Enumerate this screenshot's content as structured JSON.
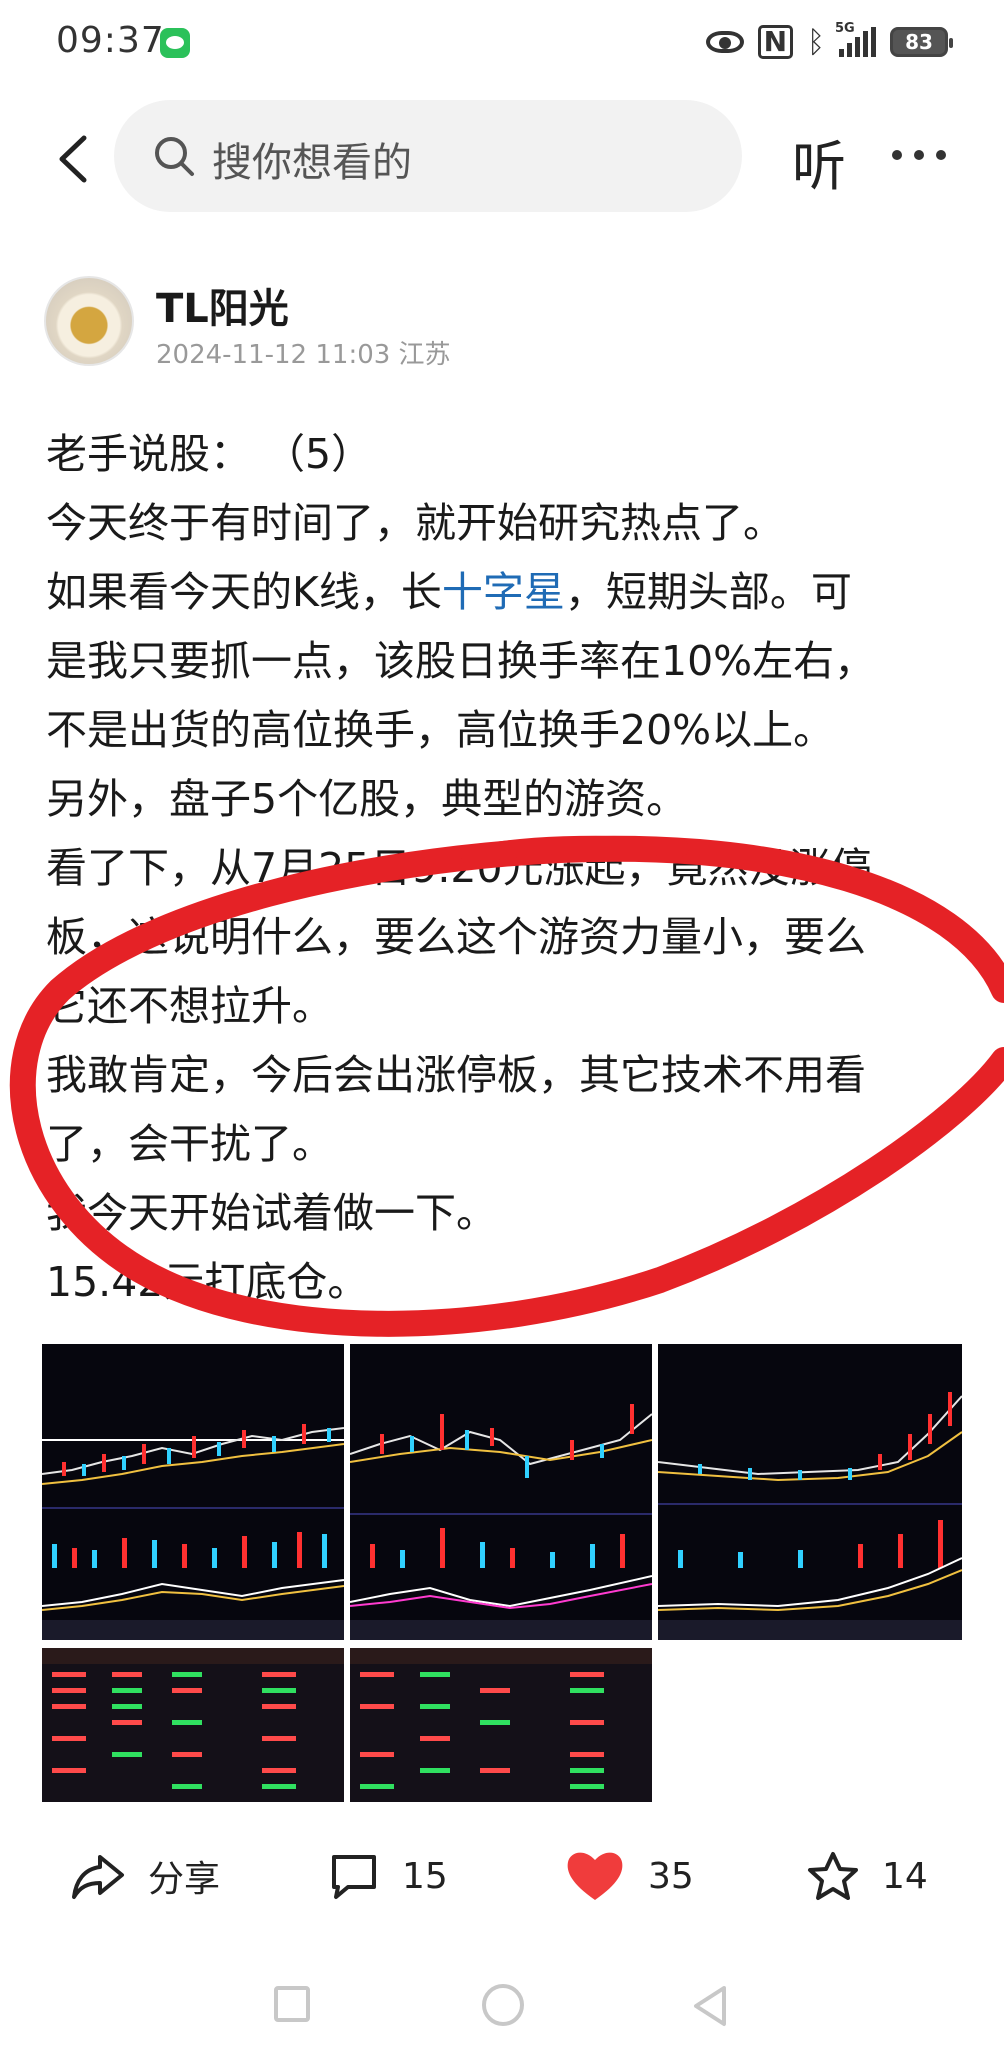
{
  "status_bar": {
    "time": "09:37",
    "network_tag": "5G",
    "battery": "83",
    "icons": [
      "wechat-icon",
      "eye-icon",
      "nfc-icon",
      "bluetooth-icon",
      "signal-icon",
      "battery-icon"
    ]
  },
  "nav": {
    "back_icon": "chevron-left-icon",
    "search_placeholder": "搜你想看的",
    "listen_label": "听",
    "more_icon": "more-dots-icon"
  },
  "author": {
    "name": "TL阳光",
    "meta": "2024-11-12 11:03 江苏"
  },
  "post": {
    "lines": [
      "老手说股：   （5）",
      "今天终于有时间了，就开始研究热点了。",
      "如果看今天的K线，长",
      "，短期头部。可",
      "是我只要抓一点，该股日换手率在10%左右，",
      "不是出货的高位换手，高位换手20%以上。",
      "另外，盘子5个亿股，典型的游资。",
      "看了下，从7月25日9.20元涨起，竟然没涨停",
      "板，这说明什么，要么这个游资力量小，要么",
      "它还不想拉升。",
      "我敢肯定，今后会出涨停板，其它技术不用看",
      "了，会干扰了。",
      "我今天开始试着做一下。",
      "15.42元打底仓。"
    ],
    "link_text": "十字星",
    "link_color": "#1f6bb5"
  },
  "images": {
    "count": 5,
    "kinds": [
      "stock-kline-chart",
      "stock-kline-chart",
      "stock-kline-chart",
      "stock-quote-table",
      "stock-quote-table"
    ]
  },
  "actions": {
    "share_label": "分享",
    "comment_count": "15",
    "like_count": "35",
    "favorite_count": "14",
    "like_color": "#f03c3c"
  },
  "colors": {
    "annotation_red": "#e52226",
    "search_bg": "#f2f2f2"
  }
}
